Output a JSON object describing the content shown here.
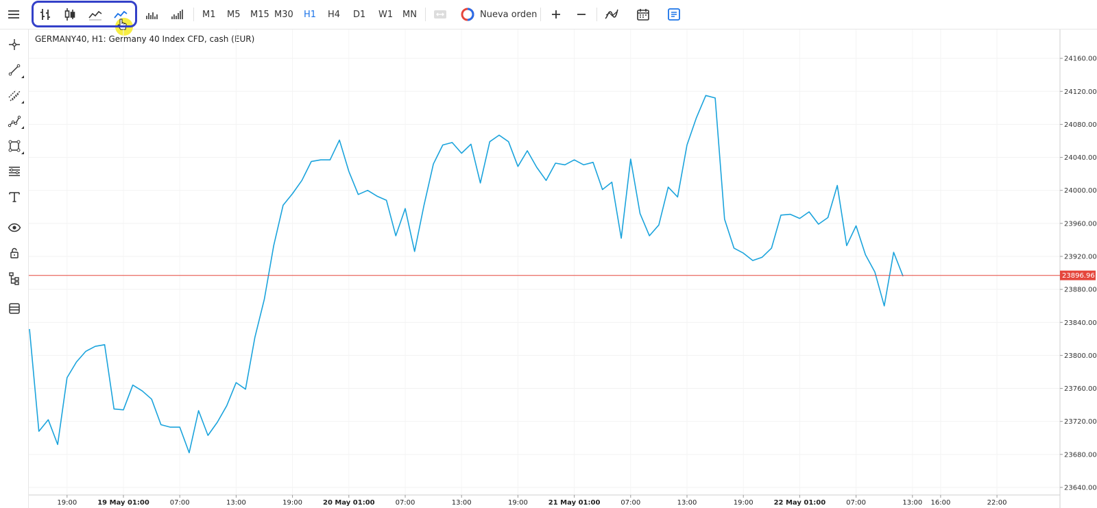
{
  "toolbar": {
    "menu_icon": "hamburger-menu-icon",
    "chart_types": [
      {
        "name": "bar-chart-type-icon"
      },
      {
        "name": "candlestick-chart-type-icon"
      },
      {
        "name": "line-chart-type-icon"
      },
      {
        "name": "area-chart-type-icon"
      },
      {
        "name": "volume-chart-icon"
      },
      {
        "name": "tick-volume-chart-icon"
      }
    ],
    "timeframes": [
      "M1",
      "M5",
      "M15",
      "M30",
      "H1",
      "H4",
      "D1",
      "W1",
      "MN"
    ],
    "active_timeframe": "H1",
    "new_order_label": "Nueva orden",
    "zoom_in_icon": "zoom-in-icon",
    "zoom_out_icon": "zoom-out-icon",
    "indicators_icon": "indicators-icon",
    "calendar_icon": "calendar-icon",
    "notes_icon": "notes-icon",
    "accent_color": "#1a73e8",
    "highlight_color": "#3340c8"
  },
  "sidebar": {
    "tools": [
      "crosshair-icon",
      "trend-line-icon",
      "parallel-channel-icon",
      "polyline-icon",
      "shapes-icon",
      "fibonacci-icon",
      "text-tool-icon",
      "visibility-icon",
      "lock-icon",
      "object-tree-icon",
      "layers-icon"
    ]
  },
  "chart_title": "GERMANY40, H1: Germany 40 Index CFD, cash (EUR)",
  "chart_data": {
    "type": "line",
    "title": "GERMANY40, H1: Germany 40 Index CFD, cash (EUR)",
    "line_color": "#1aa3dc",
    "price_line_color": "#e5463c",
    "current_price": 23896.96,
    "current_price_label": "23896.96",
    "ylim": [
      23630,
      24195
    ],
    "y_ticks": [
      "24160.00",
      "24120.00",
      "24080.00",
      "24040.00",
      "24000.00",
      "23960.00",
      "23920.00",
      "23880.00",
      "23840.00",
      "23800.00",
      "23760.00",
      "23720.00",
      "23680.00",
      "23640.00"
    ],
    "x_ticks": [
      {
        "label": "19:00",
        "bold": false,
        "i": 4
      },
      {
        "label": "19 May 01:00",
        "bold": true,
        "i": 10
      },
      {
        "label": "07:00",
        "bold": false,
        "i": 16
      },
      {
        "label": "13:00",
        "bold": false,
        "i": 22
      },
      {
        "label": "19:00",
        "bold": false,
        "i": 28
      },
      {
        "label": "20 May 01:00",
        "bold": true,
        "i": 34
      },
      {
        "label": "07:00",
        "bold": false,
        "i": 40
      },
      {
        "label": "13:00",
        "bold": false,
        "i": 46
      },
      {
        "label": "19:00",
        "bold": false,
        "i": 52
      },
      {
        "label": "21 May 01:00",
        "bold": true,
        "i": 58
      },
      {
        "label": "07:00",
        "bold": false,
        "i": 64
      },
      {
        "label": "13:00",
        "bold": false,
        "i": 70
      },
      {
        "label": "19:00",
        "bold": false,
        "i": 76
      },
      {
        "label": "22 May 01:00",
        "bold": true,
        "i": 82
      },
      {
        "label": "07:00",
        "bold": false,
        "i": 88
      },
      {
        "label": "13:00",
        "bold": false,
        "i": 94
      },
      {
        "label": "16:00",
        "bold": false,
        "i": 97
      },
      {
        "label": "22:00",
        "bold": false,
        "i": 103
      }
    ],
    "series": [
      {
        "values": [
          23832,
          23708,
          23722,
          23692,
          23773,
          23792,
          23805,
          23811,
          23813,
          23735,
          23734,
          23764,
          23757,
          23747,
          23716,
          23713,
          23713,
          23682,
          23733,
          23703,
          23719,
          23739,
          23767,
          23759,
          23822,
          23868,
          23933,
          23982,
          23996,
          24012,
          24035,
          24037,
          24037,
          24061,
          24023,
          23995,
          24000,
          23993,
          23988,
          23945,
          23978,
          23926,
          23982,
          24032,
          24055,
          24058,
          24045,
          24056,
          24009,
          24059,
          24067,
          24059,
          24029,
          24048,
          24028,
          24012,
          24033,
          24031,
          24037,
          24031,
          24034,
          24001,
          24010,
          23942,
          24038,
          23972,
          23945,
          23958,
          24004,
          23992,
          24055,
          24088,
          24115,
          24112,
          23965,
          23930,
          23924,
          23915,
          23919,
          23930,
          23970,
          23971,
          23966,
          23974,
          23959,
          23967,
          24006,
          23933,
          23957,
          23922,
          23901,
          23860,
          23925,
          23896
        ]
      }
    ]
  }
}
